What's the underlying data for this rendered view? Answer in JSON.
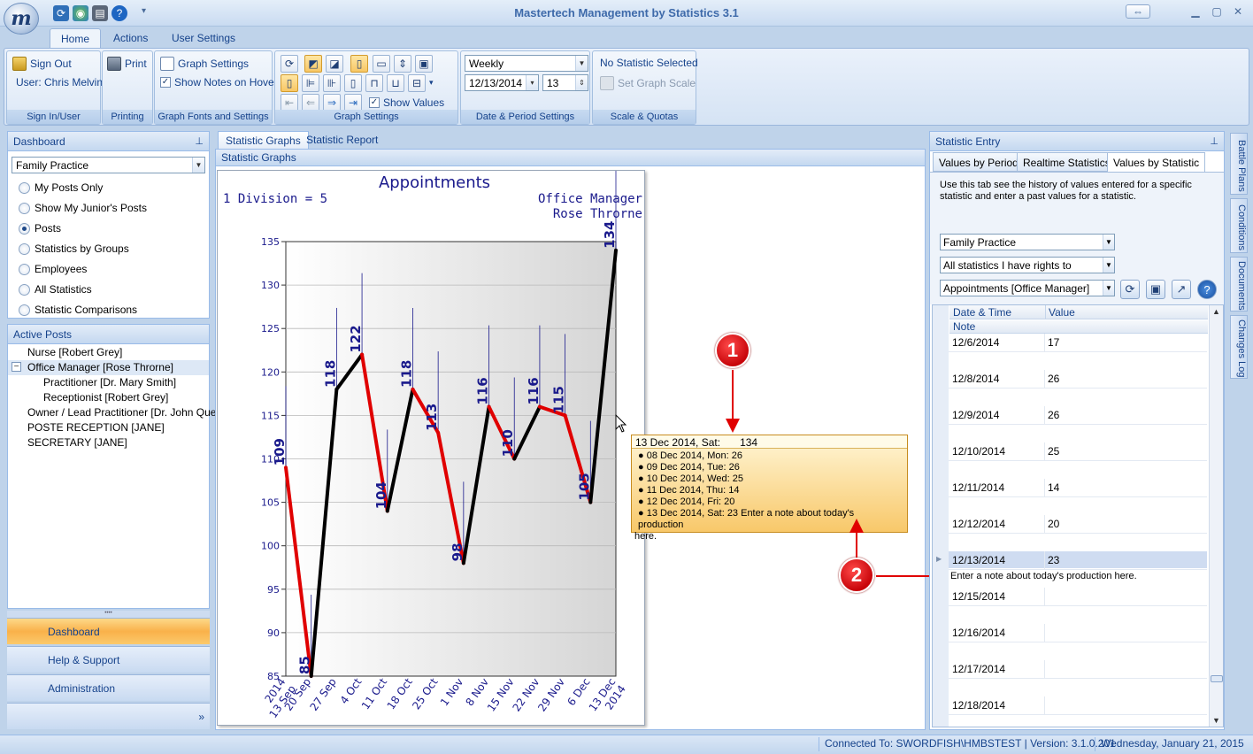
{
  "window": {
    "title": "Mastertech Management by Statistics 3.1",
    "logo_letter": "m"
  },
  "ribbon_tabs": [
    "Home",
    "Actions",
    "User Settings"
  ],
  "ribbon": {
    "sign_in": {
      "sign_out": "Sign Out",
      "user": "User: Chris Melvin",
      "label": "Sign In/User"
    },
    "printing": {
      "print": "Print",
      "label": "Printing"
    },
    "fonts": {
      "graph_settings": "Graph Settings",
      "show_notes": "Show Notes on Hover",
      "label": "Graph Fonts and Settings"
    },
    "graph": {
      "show_values": "Show Values",
      "label": "Graph Settings"
    },
    "date": {
      "period": "Weekly",
      "date": "12/13/2014",
      "count": "13",
      "label": "Date & Period Settings"
    },
    "scale": {
      "no_statistic": "No Statistic Selected",
      "set_scale": "Set Graph Scale",
      "label": "Scale & Quotas"
    }
  },
  "dashboard": {
    "title": "Dashboard",
    "org": "Family Practice",
    "options": [
      "My Posts Only",
      "Show My Junior's Posts",
      "Posts",
      "Statistics by Groups",
      "Employees",
      "All Statistics",
      "Statistic Comparisons"
    ],
    "selected": "Posts"
  },
  "active_posts": {
    "title": "Active Posts",
    "items": [
      "Nurse [Robert Grey]",
      "Office Manager [Rose Throrne]",
      "Practitioner  [Dr. Mary Smith]",
      "Receptionist  [Robert Grey]",
      "Owner / Lead Practitioner  [Dr. John Que]",
      "POSTE RECEPTION [JANE]",
      "SECRETARY [JANE]"
    ],
    "expand_glyph": "−"
  },
  "nav": [
    "Dashboard",
    "Help & Support",
    "Administration"
  ],
  "center": {
    "tabs": [
      "Statistic Graphs",
      "Statistic Report"
    ],
    "subheader": "Statistic Graphs"
  },
  "chart_data": {
    "type": "line",
    "title": "Appointments",
    "subtitle_left": "1 Division = 5",
    "subtitle_right": [
      "Office Manager",
      "Rose Throrne"
    ],
    "x": [
      "2014 13 Sep",
      "20 Sep",
      "27 Sep",
      "4 Oct",
      "11 Oct",
      "18 Oct",
      "25 Oct",
      "1 Nov",
      "8 Nov",
      "15 Nov",
      "22 Nov",
      "29 Nov",
      "6 Dec",
      "13 Dec 2014"
    ],
    "x_tick_lines": [
      [
        "2014",
        "13 Sep"
      ],
      [
        "20 Sep"
      ],
      [
        "27 Sep"
      ],
      [
        "4 Oct"
      ],
      [
        "11 Oct"
      ],
      [
        "18 Oct"
      ],
      [
        "25 Oct"
      ],
      [
        "1 Nov"
      ],
      [
        "8 Nov"
      ],
      [
        "15 Nov"
      ],
      [
        "22 Nov"
      ],
      [
        "29 Nov"
      ],
      [
        "6 Dec"
      ],
      [
        "13 Dec",
        "2014"
      ]
    ],
    "values": [
      109,
      85,
      118,
      122,
      104,
      118,
      113,
      98,
      116,
      110,
      116,
      115,
      105,
      134
    ],
    "ylim": [
      85,
      135
    ],
    "yticks": [
      85,
      90,
      95,
      100,
      105,
      110,
      115,
      120,
      125,
      130,
      135
    ],
    "colors": {
      "up": "#000000",
      "down": "#e00000",
      "labels": "#1a1a8c"
    }
  },
  "tooltip": {
    "header_date": "13 Dec 2014, Sat:",
    "header_value": "134",
    "lines": [
      "● 08 Dec 2014, Mon: 26",
      "● 09 Dec 2014, Tue: 26",
      "● 10 Dec 2014, Wed: 25",
      "● 11 Dec 2014, Thu: 14",
      "● 12 Dec 2014, Fri: 20",
      "● 13 Dec 2014, Sat: 23  Enter a note about today's production",
      "here."
    ]
  },
  "markers": [
    "1",
    "2"
  ],
  "stat_entry": {
    "title": "Statistic Entry",
    "tabs": [
      "Values by Period",
      "Realtime Statistics",
      "Values by Statistic"
    ],
    "description": "Use this tab see the history of values entered for a specific statistic and enter a past values for a statistic.",
    "combo_org": "Family Practice",
    "combo_rights": "All statistics I have rights to",
    "combo_stat": "Appointments [Office Manager]",
    "grid": {
      "headers": [
        "Date & Time",
        "Value"
      ],
      "note_header": "Note",
      "rows": [
        {
          "date": "12/6/2014",
          "value": "17",
          "note": ""
        },
        {
          "date": "12/8/2014",
          "value": "26",
          "note": ""
        },
        {
          "date": "12/9/2014",
          "value": "26",
          "note": ""
        },
        {
          "date": "12/10/2014",
          "value": "25",
          "note": ""
        },
        {
          "date": "12/11/2014",
          "value": "14",
          "note": ""
        },
        {
          "date": "12/12/2014",
          "value": "20",
          "note": ""
        },
        {
          "date": "12/13/2014",
          "value": "23",
          "note": "Enter a note about today's production here."
        },
        {
          "date": "12/15/2014",
          "value": "",
          "note": ""
        },
        {
          "date": "12/16/2014",
          "value": "",
          "note": ""
        },
        {
          "date": "12/17/2014",
          "value": "",
          "note": ""
        },
        {
          "date": "12/18/2014",
          "value": "",
          "note": ""
        }
      ],
      "selected_index": 6
    }
  },
  "side_tabs": [
    "Battle Plans",
    "Conditions",
    "Documents",
    "Changes Log"
  ],
  "status": {
    "connection": "Connected To: SWORDFISH\\HMBSTEST | Version: 3.1.0.201",
    "date": "Wednesday, January 21, 2015"
  }
}
